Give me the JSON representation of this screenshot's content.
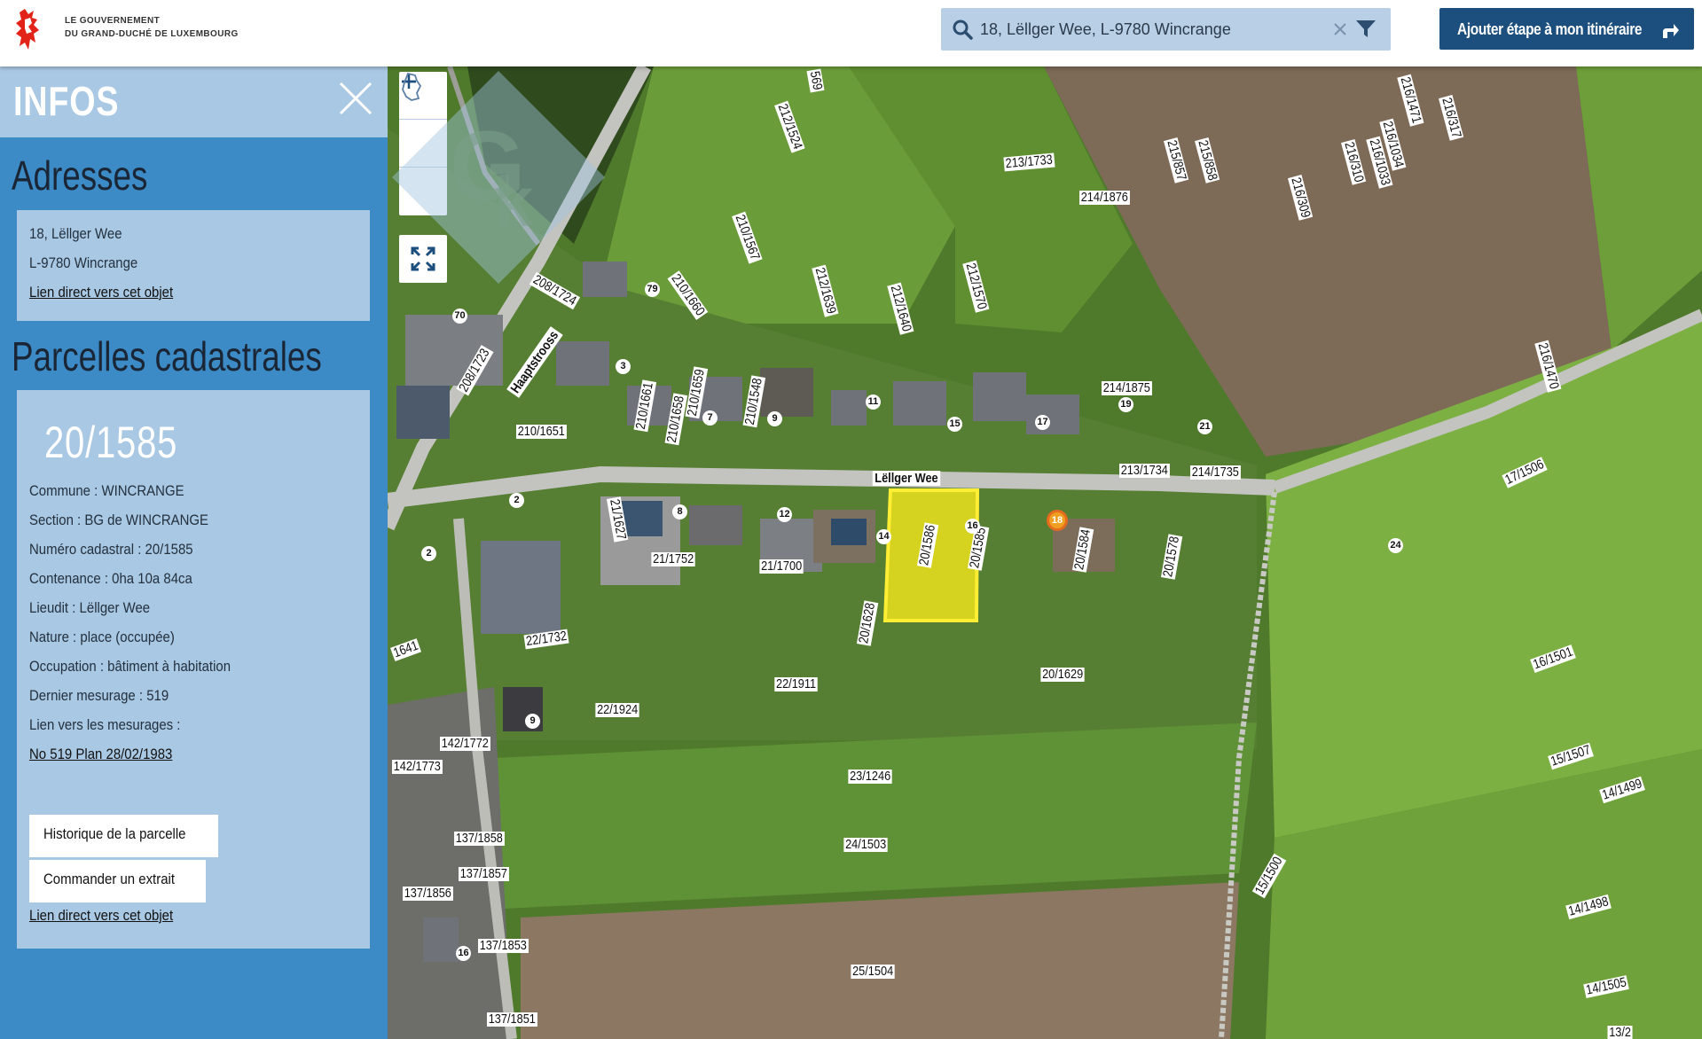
{
  "header": {
    "gov_line1": "LE GOUVERNEMENT",
    "gov_line2": "DU GRAND-DUCHÉ DE LUXEMBOURG",
    "search_value": "18, Lëllger Wee, L-9780 Wincrange",
    "route_button": "Ajouter étape à mon itinéraire"
  },
  "sidebar": {
    "title": "INFOS",
    "addresses_title": "Adresses",
    "address_line1": "18, Lëllger Wee",
    "address_line2": "L-9780 Wincrange",
    "address_link": "Lien direct vers cet objet",
    "parcels_title": "Parcelles cadastrales",
    "parcel_number": "20/1585",
    "commune": "Commune : WINCRANGE",
    "section": "Section : BG de WINCRANGE",
    "numero": "Numéro cadastral : 20/1585",
    "contenance": "Contenance : 0ha 10a 84ca",
    "lieudit": "Lieudit : Lëllger Wee",
    "nature": "Nature : place (occupée)",
    "occupation": "Occupation : bâtiment à habitation",
    "dernier_mesurage": "Dernier mesurage : 519",
    "lien_mesurages": "Lien vers les mesurages :",
    "mesurage_link": "No 519 Plan 28/02/1983",
    "historique_button": "Historique de la parcelle",
    "commander_button": "Commander un extrait",
    "parcel_link": "Lien direct vers cet objet"
  },
  "map": {
    "zoom_in": "+",
    "zoom_out": "−",
    "selected_marker": "18",
    "street_names": [
      "Lëllger Wee",
      "Haaptstrooss"
    ],
    "parcel_labels": [
      "569",
      "212/1524",
      "213/1733",
      "214/1876",
      "215/857",
      "215/858",
      "216/1471",
      "216/1034",
      "216/1033",
      "216/310",
      "216/317",
      "216/309",
      "210/1567",
      "212/1639",
      "212/1640",
      "212/1570",
      "208/1724",
      "210/1660",
      "208/1723",
      "210/1661",
      "210/1658",
      "210/1659",
      "210/1548",
      "210/1651",
      "214/1875",
      "216/1470",
      "213/1734",
      "214/1735",
      "17/1506",
      "21/1627",
      "21/1752",
      "21/1700",
      "20/1586",
      "20/1585",
      "20/1584",
      "20/1578",
      "20/1628",
      "20/1629",
      "22/1732",
      "22/1911",
      "22/1924",
      "16/1501",
      "1641",
      "142/1772",
      "142/1773",
      "23/1246",
      "15/1507",
      "14/1499",
      "137/1858",
      "24/1503",
      "137/1857",
      "137/1856",
      "15/1500",
      "14/1498",
      "137/1853",
      "25/1504",
      "14/1505",
      "137/1851",
      "13/2"
    ],
    "house_numbers": [
      "79",
      "70",
      "3",
      "7",
      "9",
      "11",
      "15",
      "17",
      "19",
      "21",
      "2",
      "8",
      "12",
      "14",
      "16",
      "24",
      "2",
      "9",
      "16"
    ]
  },
  "colors": {
    "header_bg": "#ffffff",
    "sidebar_bg": "#3c8bc6",
    "sidebar_panel": "#a9c8e3",
    "search_bg": "#b8cfe6",
    "route_button_bg": "#1c4f7d",
    "selection": "#f5e71c"
  }
}
